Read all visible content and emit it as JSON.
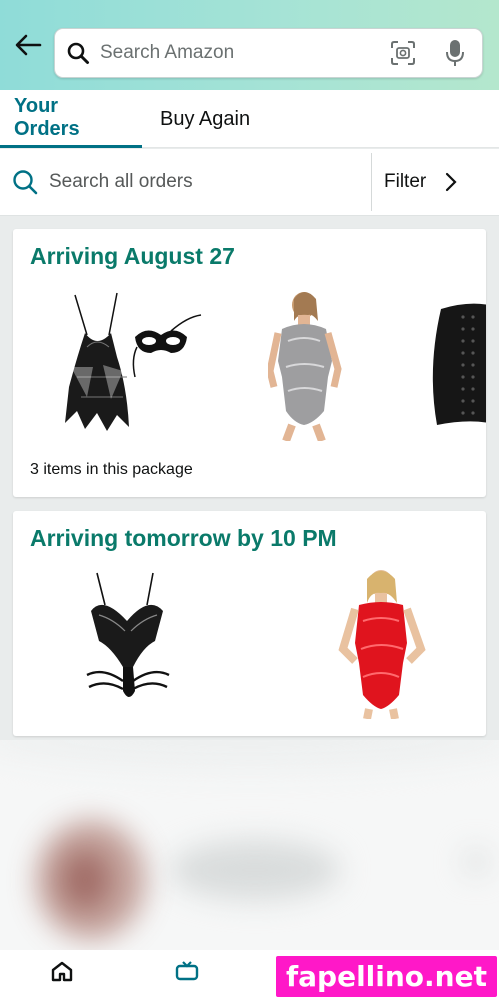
{
  "header": {
    "search_placeholder": "Search Amazon",
    "icons": [
      "back-arrow-icon",
      "search-icon",
      "camera-scan-icon",
      "microphone-icon"
    ]
  },
  "tabs": [
    {
      "label": "Your Orders",
      "active": true
    },
    {
      "label": "Buy Again",
      "active": false
    }
  ],
  "order_search": {
    "placeholder": "Search all orders",
    "filter_label": "Filter"
  },
  "orders": [
    {
      "arrival": "Arriving August 27",
      "items_note": "3 items in this package",
      "products": [
        "black lace babydoll with mask",
        "grey lace bodysuit",
        "black waist trainer"
      ]
    },
    {
      "arrival": "Arriving tomorrow by 10 PM",
      "products": [
        "black lace strappy teddy",
        "red lace bodysuit"
      ]
    }
  ],
  "watermark": "fapellino.net",
  "colors": {
    "accent": "#007185",
    "heading": "#0a7a6a",
    "header_gradient_start": "#8fdcd8",
    "header_gradient_end": "#b4e7cd",
    "watermark_bg": "#ff18c8"
  }
}
